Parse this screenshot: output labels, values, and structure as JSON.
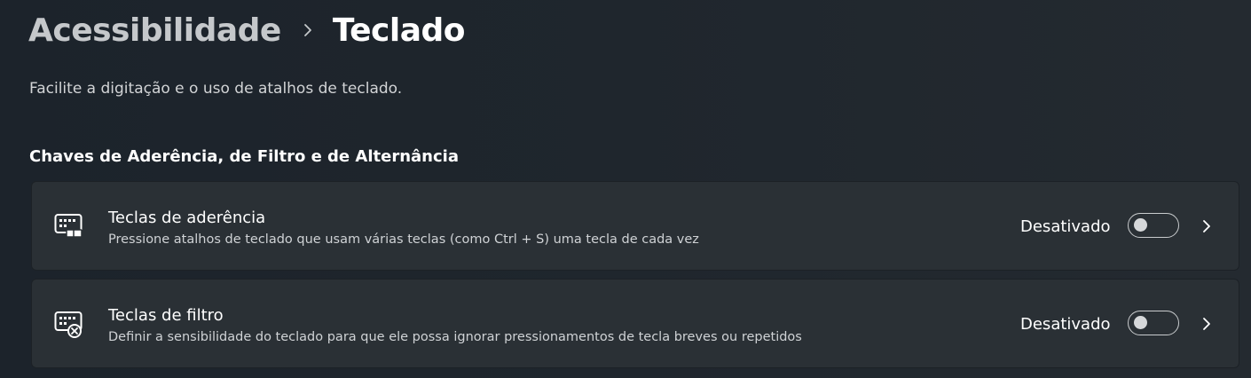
{
  "breadcrumb": {
    "parent": "Acessibilidade",
    "current": "Teclado"
  },
  "description": "Facilite a digitação e o uso de atalhos de teclado.",
  "section": {
    "title": "Chaves de Aderência, de Filtro e de Alternância"
  },
  "settings": [
    {
      "title": "Teclas de aderência",
      "description": "Pressione atalhos de teclado que usam várias teclas (como Ctrl + S) uma tecla de cada vez",
      "state_label": "Desativado",
      "enabled": false,
      "icon": "sticky-keys-icon"
    },
    {
      "title": "Teclas de filtro",
      "description": "Definir a sensibilidade do teclado para que ele possa ignorar pressionamentos de tecla breves ou repetidos",
      "state_label": "Desativado",
      "enabled": false,
      "icon": "filter-keys-icon"
    }
  ],
  "colors": {
    "background": "#1f262d",
    "card": "#2a3035",
    "toggle_off": "#d6d8da"
  }
}
